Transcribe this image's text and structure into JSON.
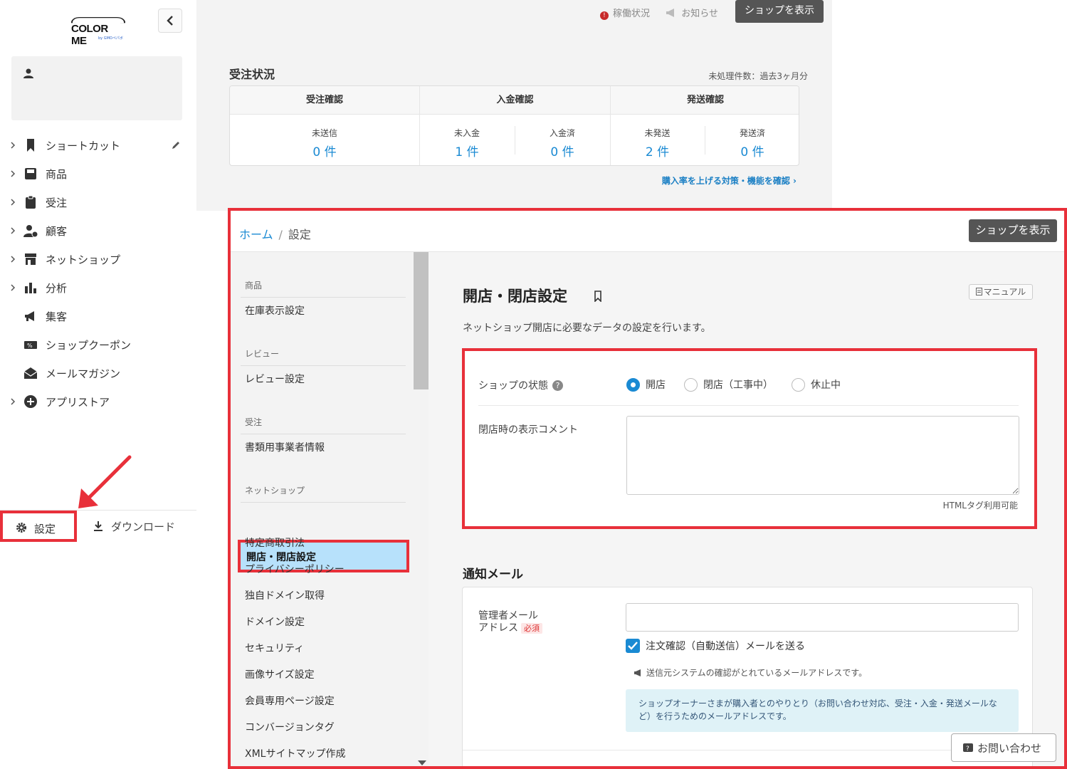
{
  "logo": {
    "text": "COLOR ME",
    "sub": "by GMOペパボ"
  },
  "sidebar": {
    "items": [
      {
        "label": "ショートカット"
      },
      {
        "label": "商品"
      },
      {
        "label": "受注"
      },
      {
        "label": "顧客"
      },
      {
        "label": "ネットショップ"
      },
      {
        "label": "分析"
      },
      {
        "label": "集客"
      },
      {
        "label": "ショップクーポン"
      },
      {
        "label": "メールマガジン"
      },
      {
        "label": "アプリストア"
      }
    ],
    "settings_label": "設定",
    "download_label": "ダウンロード"
  },
  "topbar": {
    "status_label": "稼働状況",
    "notice_label": "お知らせ",
    "view_shop_label": "ショップを表示"
  },
  "orders": {
    "title": "受注状況",
    "note": "未処理件数：過去3ヶ月分",
    "groups": [
      {
        "title": "受注確認"
      },
      {
        "title": "入金確認"
      },
      {
        "title": "発送確認"
      }
    ],
    "cells": [
      {
        "key": "未送信",
        "value": "0 件"
      },
      {
        "key": "未入金",
        "value": "1 件"
      },
      {
        "key": "入金済",
        "value": "0 件"
      },
      {
        "key": "未発送",
        "value": "2 件"
      },
      {
        "key": "発送済",
        "value": "0 件"
      }
    ],
    "link": "購入率を上げる対策・機能を確認 ›"
  },
  "panel": {
    "breadcrumb": {
      "home": "ホーム",
      "sep": "/",
      "current": "設定"
    },
    "view_shop_label": "ショップを表示",
    "subnav": {
      "categories": [
        "商品",
        "レビュー",
        "受注",
        "ネットショップ"
      ],
      "items": [
        "在庫表示設定",
        "レビュー設定",
        "書類用事業者情報",
        "開店・閉店設定",
        "特定商取引法",
        "プライバシーポリシー",
        "独自ドメイン取得",
        "ドメイン設定",
        "セキュリティ",
        "画像サイズ設定",
        "会員専用ページ設定",
        "コンバージョンタグ",
        "XMLサイトマップ作成"
      ]
    },
    "title": "開店・閉店設定",
    "manual_label": "マニュアル",
    "description": "ネットショップ開店に必要なデータの設定を行います。",
    "shop_state": {
      "label": "ショップの状態",
      "help": "?",
      "options": [
        "開店",
        "閉店（工事中）",
        "休止中"
      ],
      "selected": "開店"
    },
    "closed_comment": {
      "label": "閉店時の表示コメント",
      "value": "",
      "note": "HTMLタグ利用可能"
    },
    "notify": {
      "title": "通知メール",
      "admin_email_label_1": "管理者メール",
      "admin_email_label_2": "アドレス",
      "required": "必須",
      "email_value": "",
      "checkbox_label": "注文確認（自動送信）メールを送る",
      "sender_note": "送信元システムの確認がとれているメールアドレスです。",
      "info": "ショップオーナーさまが購入者とのやりとり（お問い合わせ対応、受注・入金・発送メールなど）を行うためのメールアドレスです。"
    },
    "contact_label": "お問い合わせ"
  },
  "colors": {
    "accent": "#1a8ad3",
    "highlight": "#e8303a",
    "active_bg": "#b7e1fb"
  }
}
